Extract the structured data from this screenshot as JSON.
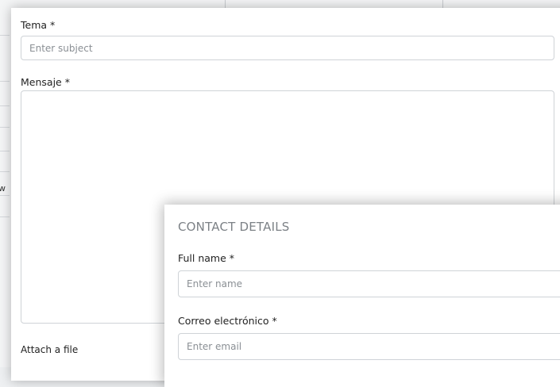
{
  "message_form": {
    "subject_label": "Tema *",
    "subject_placeholder": "Enter subject",
    "subject_value": "",
    "message_label": "Mensaje *",
    "message_value": "",
    "attach_label": "Attach a file"
  },
  "contact_details": {
    "title": "CONTACT DETAILS",
    "name_label": "Full name *",
    "name_placeholder": "Enter name",
    "email_label": "Correo electrónico *",
    "email_placeholder": "Enter email"
  },
  "background": {
    "clipped_text": "w"
  }
}
